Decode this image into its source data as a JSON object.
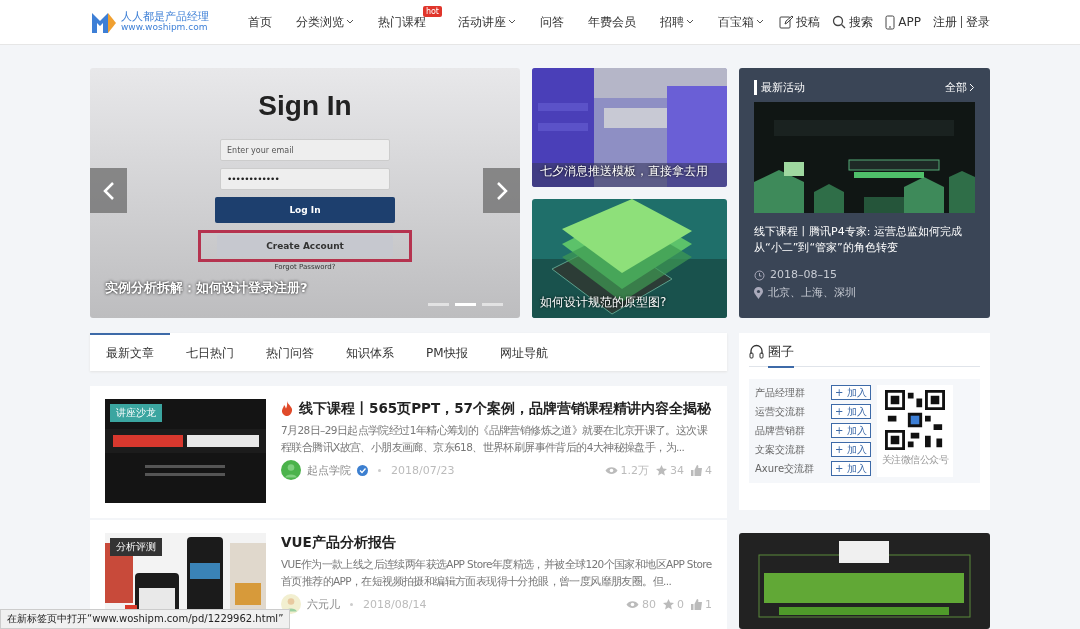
{
  "header": {
    "logo_name": "人人都是产品经理",
    "logo_url": "www.woshipm.com",
    "nav": [
      {
        "label": "首页",
        "dropdown": false
      },
      {
        "label": "分类浏览",
        "dropdown": true
      },
      {
        "label": "热门课程",
        "dropdown": false,
        "badge": "hot"
      },
      {
        "label": "活动讲座",
        "dropdown": true
      },
      {
        "label": "问答",
        "dropdown": false
      },
      {
        "label": "年费会员",
        "dropdown": false
      },
      {
        "label": "招聘",
        "dropdown": true
      },
      {
        "label": "百宝箱",
        "dropdown": true
      }
    ],
    "actions": [
      {
        "kind": "edit",
        "label": "投稿"
      },
      {
        "kind": "search",
        "label": "搜索"
      },
      {
        "kind": "phone",
        "label": "APP"
      }
    ],
    "auth": [
      "注册",
      "登录"
    ]
  },
  "carousel": {
    "caption": "实例分析拆解：如何设计登录注册?",
    "mockup": {
      "title": "Sign In",
      "email_placeholder": "Enter your email",
      "password": "••••••••••••",
      "login": "Log In",
      "create": "Create Account",
      "forgot": "Forgot Password?"
    },
    "dots": [
      {
        "selected": false
      },
      {
        "selected": true
      },
      {
        "selected": false
      }
    ]
  },
  "side_cards": [
    {
      "caption": "七夕消息推送模板，直接拿去用",
      "kind": "picture"
    },
    {
      "caption": "如何设计规范的原型图?",
      "kind": "picture"
    }
  ],
  "event": {
    "title": "最新活动",
    "more": "全部",
    "headline": "线下课程丨腾讯P4专家: 运营总监如何完成从“小二”到“管家”的角色转变",
    "date": "2018–08–15",
    "location": "北京、上海、深圳"
  },
  "tabs": [
    {
      "label": "最新文章",
      "selected": true
    },
    {
      "label": "七日热门",
      "selected": false
    },
    {
      "label": "热门问答",
      "selected": false
    },
    {
      "label": "知识体系",
      "selected": false
    },
    {
      "label": "PM快报",
      "selected": false
    },
    {
      "label": "网址导航",
      "selected": false
    }
  ],
  "articles": [
    {
      "tag": "讲座沙龙",
      "hot": true,
      "title": "线下课程丨565页PPT，57个案例，品牌营销课程精讲内容全揭秘",
      "excerpt": "7月28日–29日起点学院经过1年精心筹划的《品牌营销修炼之道》就要在北京开课了。这次课程联合腾讯X故宫、小朋友画廊、京东618、世界杯刷屏事件背后的4大神秘操盘手，为...",
      "author": "起点学院",
      "verified": true,
      "date": "2018/07/23",
      "views": "1.2万",
      "favorites": "34",
      "likes": "4"
    },
    {
      "tag": "分析评测",
      "hot": false,
      "title": "VUE产品分析报告",
      "excerpt": "VUE作为一款上线之后连续两年获选APP Store年度精选，并被全球120个国家和地区APP Store 首页推荐的APP，在短视频拍摄和编辑方面表现得十分抢眼，曾一度风靡朋友圈。但...",
      "author": "六元儿",
      "verified": false,
      "date": "2018/08/14",
      "views": "80",
      "favorites": "0",
      "likes": "1"
    }
  ],
  "circle": {
    "title": "圈子",
    "groups": [
      {
        "name": "产品经理群",
        "action": "+ 加入"
      },
      {
        "name": "运营交流群",
        "action": "+ 加入"
      },
      {
        "name": "品牌营销群",
        "action": "+ 加入"
      },
      {
        "name": "文案交流群",
        "action": "+ 加入"
      },
      {
        "name": "Axure交流群",
        "action": "+ 加入"
      }
    ],
    "qr_caption": "关注微信公众号"
  },
  "status_tip": "在新标签页中打开“www.woshipm.com/pd/1229962.html”"
}
